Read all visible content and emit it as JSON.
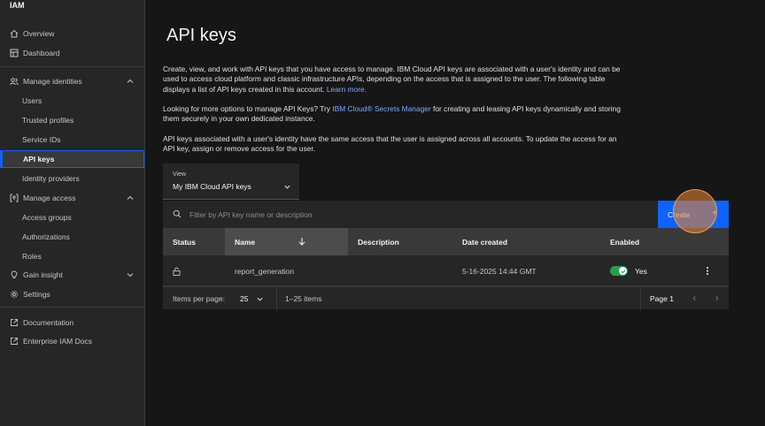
{
  "sidebar": {
    "title": "IAM",
    "items": {
      "overview": "Overview",
      "dashboard": "Dashboard",
      "manage_identities": "Manage identities",
      "users": "Users",
      "trusted_profiles": "Trusted profiles",
      "service_ids": "Service IDs",
      "api_keys": "API keys",
      "identity_providers": "Identity providers",
      "manage_access": "Manage access",
      "access_groups": "Access groups",
      "authorizations": "Authorizations",
      "roles": "Roles",
      "gain_insight": "Gain insight",
      "settings": "Settings",
      "documentation": "Documentation",
      "enterprise_docs": "Enterprise IAM Docs"
    }
  },
  "main": {
    "title": "API keys",
    "intro_p1": "Create, view, and work with API keys that you have access to manage. IBM Cloud API keys are associated with a user's identity and can be used to access cloud platform and classic infrastructure APIs, depending on the access that is assigned to the user. The following table displays a list of API keys created in this account.",
    "intro_p1_link": "Learn more.",
    "intro_p2_a": "Looking for more options to manage API Keys? Try",
    "intro_p2_link": "IBM Cloud® Secrets Manager",
    "intro_p2_b": "for creating and leasing API keys dynamically and storing them securely in your own dedicated instance.",
    "intro_p3": "API keys associated with a user's identity have the same access that the user is assigned across all accounts. To update the access for an API key, assign or remove access for the user.",
    "view": {
      "label": "View",
      "value": "My IBM Cloud API keys"
    },
    "search": {
      "placeholder": "Filter by API key name or description"
    },
    "create_label": "Create",
    "create_plus": "+",
    "columns": {
      "status": "Status",
      "name": "Name",
      "description": "Description",
      "date_created": "Date created",
      "enabled": "Enabled"
    },
    "rows": [
      {
        "name": "report_generation",
        "description": "",
        "date_created": "5-16-2025 14:44 GMT",
        "enabled": "Yes"
      }
    ],
    "pagination": {
      "items_per_page_label": "Items per page:",
      "items_per_page_value": "25",
      "range": "1–25 items",
      "page_label": "Page 1"
    }
  },
  "colors": {
    "accent": "#0f62fe",
    "link": "#78a9ff",
    "toggle_on": "#24a148",
    "cursor": "#e08030"
  }
}
